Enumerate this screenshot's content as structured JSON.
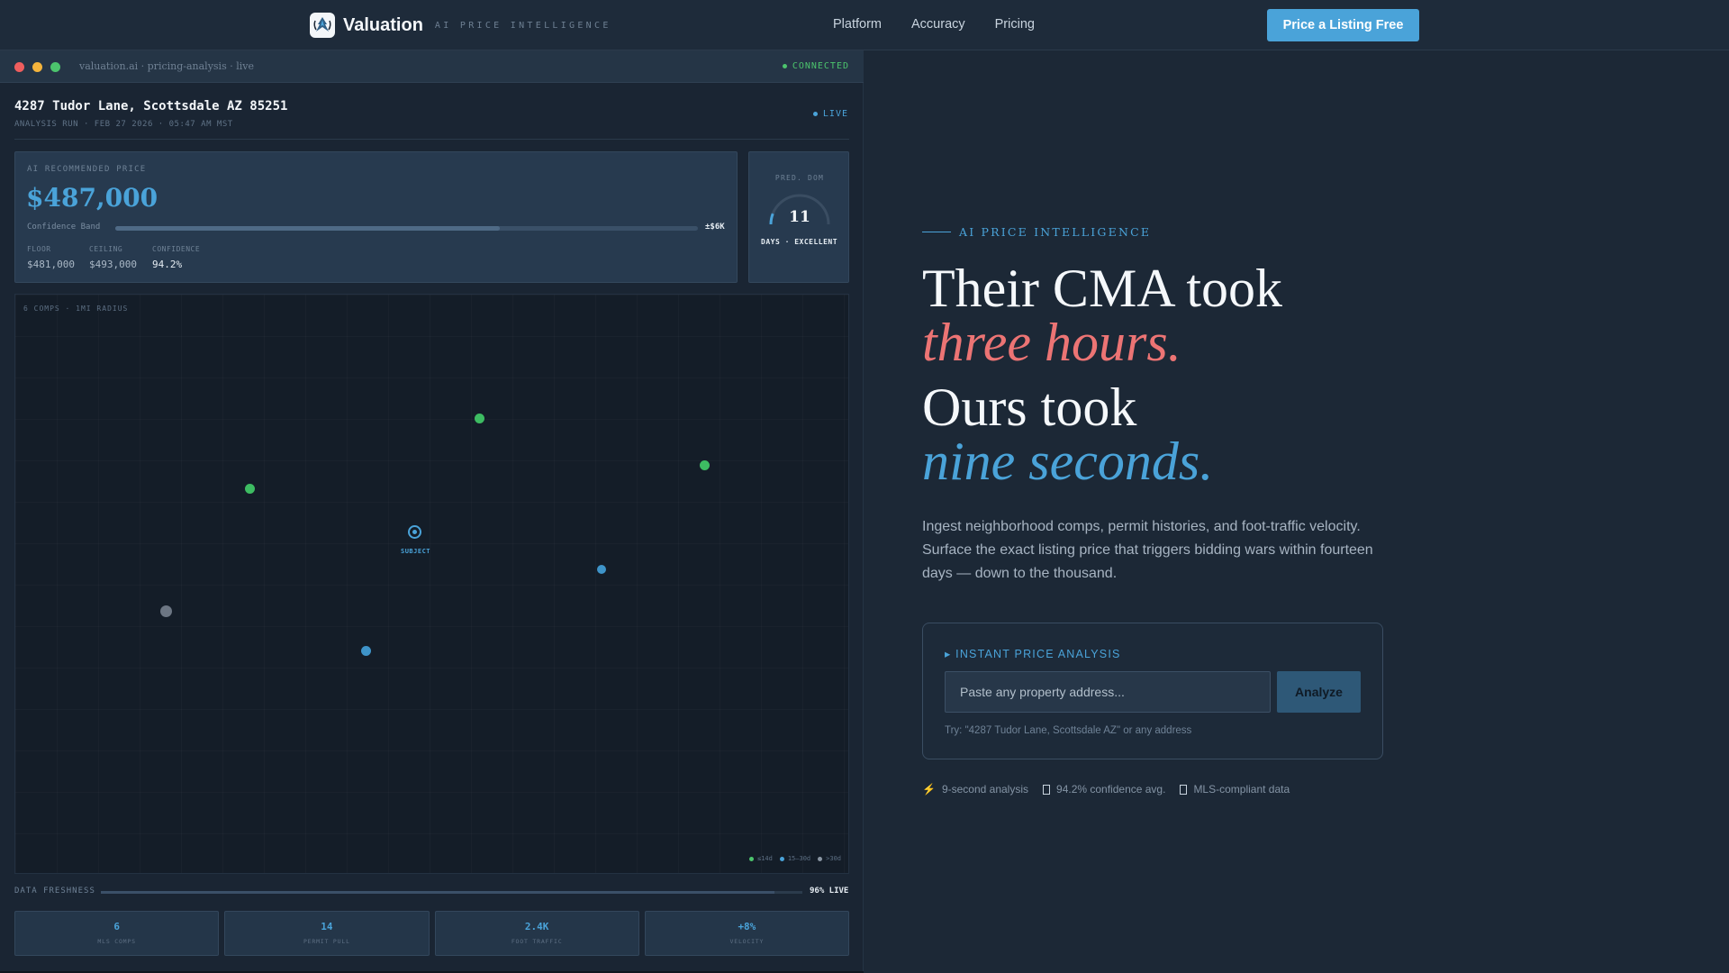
{
  "nav": {
    "brand": "Valuation",
    "tagline": "AI PRICE INTELLIGENCE",
    "links": [
      "Platform",
      "Accuracy",
      "Pricing"
    ],
    "cta": "Price a Listing Free"
  },
  "panel": {
    "url": "valuation.ai · pricing-analysis · live",
    "status": "CONNECTED",
    "address": "4287 Tudor Lane, Scottsdale AZ 85251",
    "run_info": "ANALYSIS RUN · FEB 27 2026 · 05:47 AM MST",
    "live": "LIVE",
    "price_card": {
      "label": "AI RECOMMENDED PRICE",
      "price": "$487,000",
      "band_label": "Confidence Band",
      "band_value": "±$6K",
      "band_fill": 0.66,
      "floor_label": "FLOOR",
      "floor": "$481,000",
      "ceiling_label": "CEILING",
      "ceiling": "$493,000",
      "confidence_label": "CONFIDENCE",
      "confidence": "94.2%"
    },
    "dom": {
      "label": "PRED. DOM",
      "value": "11",
      "status": "DAYS · EXCELLENT",
      "gauge_fraction": 0.12
    },
    "map": {
      "label": "6 COMPS · 1MI RADIUS",
      "subject_label": "SUBJECT",
      "legend": [
        {
          "label": "≤14d",
          "color": "#4cc46d"
        },
        {
          "label": "15–30d",
          "color": "#4aa3d9"
        },
        {
          "label": ">30d",
          "color": "#8a96a3"
        }
      ],
      "comps_colors": {
        "green": "#3dbc62",
        "blue": "#3e94c9",
        "gray": "#6c7683"
      }
    },
    "freshness": {
      "label": "DATA FRESHNESS",
      "value": "96% LIVE",
      "fraction": 0.96
    },
    "tiles": [
      {
        "value": "6",
        "label": "MLS COMPS"
      },
      {
        "value": "14",
        "label": "PERMIT PULL"
      },
      {
        "value": "2.4K",
        "label": "FOOT TRAFFIC"
      },
      {
        "value": "+8%",
        "label": "VELOCITY"
      }
    ]
  },
  "hero": {
    "eyebrow": "AI PRICE INTELLIGENCE",
    "line1": "Their CMA took",
    "line2": "three hours.",
    "line3": "Ours took",
    "line4": "nine seconds.",
    "sub": "Ingest neighborhood comps, permit histories, and foot-traffic velocity. Surface the exact listing price that triggers bidding wars within fourteen days — down to the thousand."
  },
  "form": {
    "label": "▸ INSTANT PRICE ANALYSIS",
    "placeholder": "Paste any property address...",
    "button": "Analyze",
    "hint": "Try: \"4287 Tudor Lane, Scottsdale AZ\" or any address"
  },
  "trust": [
    {
      "icon": "lightning-icon",
      "label": "9-second analysis"
    },
    {
      "icon": "shield-icon",
      "label": "94.2% confidence avg."
    },
    {
      "icon": "document-icon",
      "label": "MLS-compliant data"
    }
  ],
  "colors": {
    "accent": "#4aa3d9",
    "danger": "#ec7474",
    "success": "#4cc46d"
  }
}
